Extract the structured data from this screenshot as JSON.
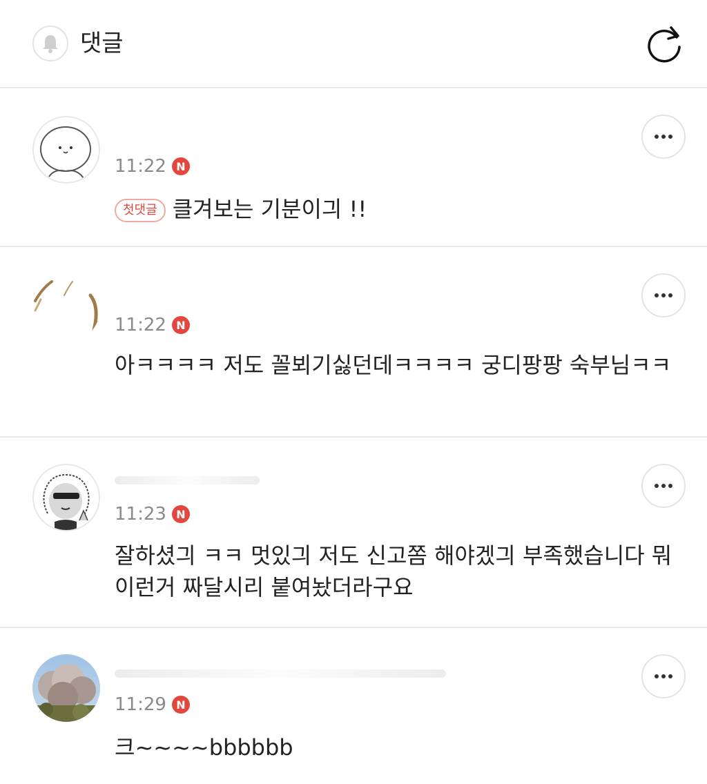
{
  "header": {
    "title": "댓글",
    "bell_icon": "bell-icon",
    "refresh_icon": "refresh-icon"
  },
  "comments": [
    {
      "time": "11:22",
      "new_badge": "N",
      "first_badge": "첫댓글",
      "text": "클겨보는 기분이긔 !!",
      "avatar": "cartoon-avatar"
    },
    {
      "time": "11:22",
      "new_badge": "N",
      "text": "아ㅋㅋㅋㅋ 저도 꼴뵈기싫던데ㅋㅋㅋㅋ 궁디팡팡 숙부님ㅋㅋ",
      "avatar": "brush-avatar"
    },
    {
      "time": "11:23",
      "new_badge": "N",
      "text": "잘하셨긔 ㅋㅋ 멋있긔 저도 신고쫌 해야겠긔 부족했습니다 뭐 이런거 짜달시리 붙여놨더라구요",
      "avatar": "sunglasses-avatar"
    },
    {
      "time": "11:29",
      "new_badge": "N",
      "text": "크~~~~bbbbbb",
      "avatar": "tree-photo-avatar"
    }
  ],
  "colors": {
    "accent_red": "#e2463c",
    "meta_gray": "#8a8a8a",
    "divider": "#e9e9e9"
  }
}
